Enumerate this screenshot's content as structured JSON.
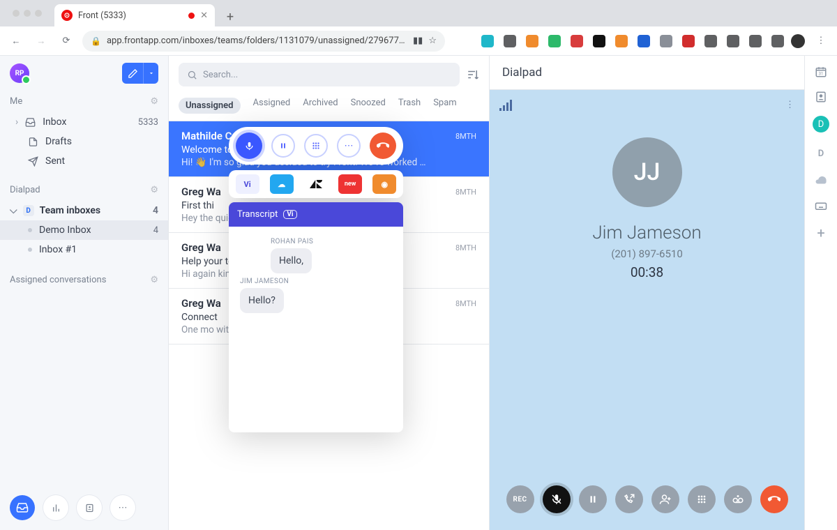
{
  "browser": {
    "tab_title": "Front (5333)",
    "url": "app.frontapp.com/inboxes/teams/folders/1131079/unassigned/279677…",
    "extensions": [
      "#1fb7c9",
      "#5f6062",
      "#f08b2d",
      "#2db96a",
      "#d83c3c",
      "#111111",
      "#f08b2d",
      "#2062d4",
      "#8a8f98",
      "#d12d2d",
      "#5f6062",
      "#5f6062",
      "#5f6062",
      "#5f6062"
    ]
  },
  "sidebar": {
    "avatar": "RP",
    "me_label": "Me",
    "items": [
      {
        "label": "Inbox",
        "count": "5333",
        "icon": "inbox"
      },
      {
        "label": "Drafts",
        "icon": "draft"
      },
      {
        "label": "Sent",
        "icon": "sent"
      }
    ],
    "section2": "Dialpad",
    "tree_label": "Team inboxes",
    "tree_count": "4",
    "tree_children": [
      {
        "label": "Demo Inbox",
        "count": "4",
        "selected": true
      },
      {
        "label": "Inbox #1"
      }
    ],
    "section3": "Assigned conversations"
  },
  "list": {
    "search_placeholder": "Search...",
    "filters": [
      "Unassigned",
      "Assigned",
      "Archived",
      "Snoozed",
      "Trash",
      "Spam"
    ],
    "active_filter": 0,
    "messages": [
      {
        "sender": "Mathilde Collin",
        "time": "8MTH",
        "subject": "Welcome to Front!",
        "preview": "Hi! 👋   I'm so glad you decided to try Front! We've worked …",
        "active": true
      },
      {
        "sender": "Greg Wa",
        "time": "8MTH",
        "subject": "First thi",
        "preview": "Hey the                                                             quickly and …"
      },
      {
        "sender": "Greg Wa",
        "time": "8MTH",
        "subject": "Help your team work together",
        "preview": "Hi again                                                           king on each…"
      },
      {
        "sender": "Greg Wa",
        "time": "8MTH",
        "subject": "Connect",
        "preview": "One mo                                                              with Front h…"
      }
    ]
  },
  "overlay": {
    "transcript_label": "Transcript",
    "vi": "Vi",
    "entries": [
      {
        "name": "ROHAN PAIS",
        "text": "Hello,",
        "side": "right"
      },
      {
        "name": "JIM JAMESON",
        "text": "Hello?",
        "side": "left"
      }
    ]
  },
  "call": {
    "title": "Dialpad",
    "initials": "JJ",
    "name": "Jim Jameson",
    "phone": "(201) 897-6510",
    "duration": "00:38",
    "rec_label": "REC"
  },
  "rail": {
    "d1": "D",
    "d2": "D"
  }
}
